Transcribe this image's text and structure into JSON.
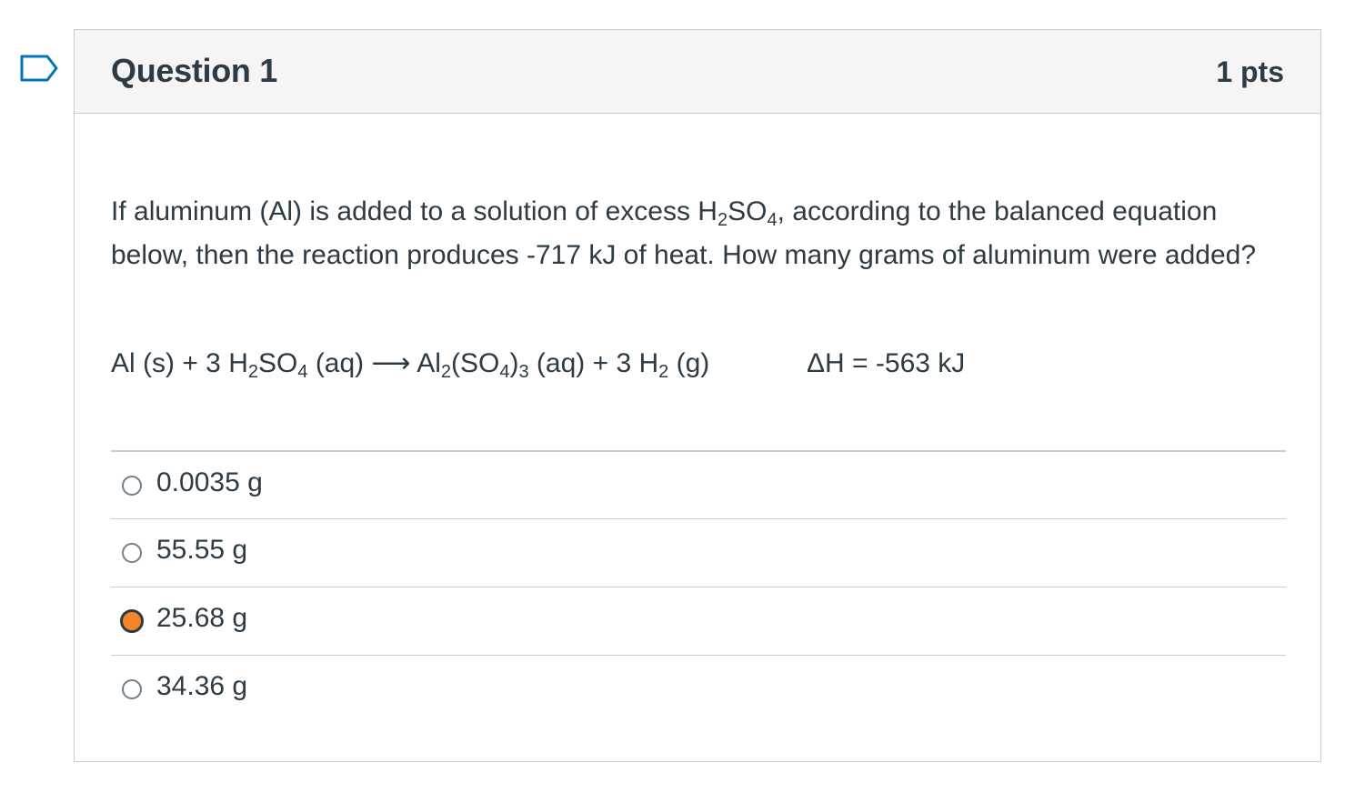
{
  "question": {
    "title": "Question 1",
    "points": "1 pts",
    "text_1": "If aluminum (Al) is added to a solution of excess H",
    "text_sub_1": "2",
    "text_2": "SO",
    "text_sub_2": "4",
    "text_3": ", according to the balanced equation below, then the reaction produces -717 kJ of heat. How many grams of aluminum were added?",
    "equation": {
      "p1": "Al (s) + 3 H",
      "s1": "2",
      "p2": "SO",
      "s2": "4",
      "p3": " (aq) ⟶ Al",
      "s3": "2",
      "p4": "(SO",
      "s4": "4",
      "p5": ")",
      "s5": "3",
      "p6": " (aq) + 3 H",
      "s6": "2",
      "p7": " (g)"
    },
    "delta_h": "ΔH = -563 kJ"
  },
  "answers": [
    {
      "label": "0.0035 g",
      "selected": false
    },
    {
      "label": "55.55 g",
      "selected": false
    },
    {
      "label": "25.68 g",
      "selected": true
    },
    {
      "label": "34.36 g",
      "selected": false
    }
  ],
  "colors": {
    "selected_fill": "#f68529",
    "text": "#2d3b45",
    "border": "#c7cdd1",
    "flag": "#0374b5"
  },
  "icons": {
    "flag": "bookmark-flag-icon"
  }
}
